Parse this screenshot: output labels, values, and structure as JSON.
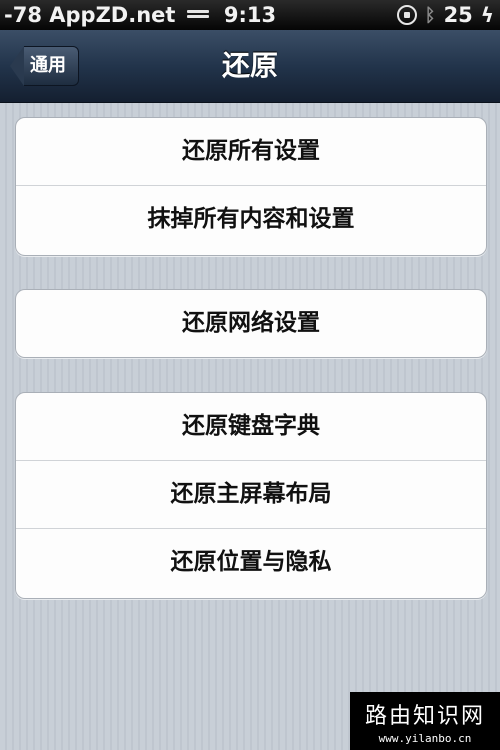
{
  "status_bar": {
    "carrier": "-78 AppZD.net",
    "time": "9:13",
    "battery": "25",
    "icons": [
      "signal-icon",
      "rotation-lock-icon",
      "bluetooth-icon",
      "charging-bolt-icon"
    ]
  },
  "nav": {
    "back_label": "通用",
    "title": "还原"
  },
  "groups": [
    {
      "items": [
        "还原所有设置",
        "抹掉所有内容和设置"
      ]
    },
    {
      "items": [
        "还原网络设置"
      ]
    },
    {
      "items": [
        "还原键盘字典",
        "还原主屏幕布局",
        "还原位置与隐私"
      ]
    }
  ],
  "watermark": {
    "title": "路由知识网",
    "url": "www.yilanbo.cn"
  },
  "colors": {
    "nav_bar": "#22344b",
    "background": "#c5ccd4",
    "cell_background": "#fdfdfd"
  }
}
